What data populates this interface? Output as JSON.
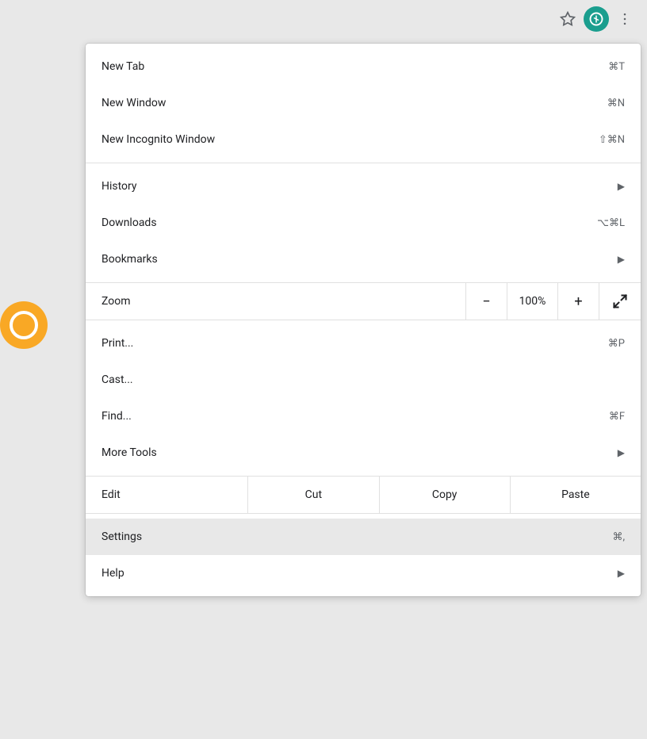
{
  "browser": {
    "icons": {
      "star": "☆",
      "dots": "⋮"
    }
  },
  "menu": {
    "sections": [
      {
        "id": "section-1",
        "items": [
          {
            "id": "new-tab",
            "label": "New Tab",
            "shortcut": "⌘T",
            "hasArrow": false
          },
          {
            "id": "new-window",
            "label": "New Window",
            "shortcut": "⌘N",
            "hasArrow": false
          },
          {
            "id": "new-incognito",
            "label": "New Incognito Window",
            "shortcut": "⇧⌘N",
            "hasArrow": false
          }
        ]
      },
      {
        "id": "section-2",
        "items": [
          {
            "id": "history",
            "label": "History",
            "shortcut": "",
            "hasArrow": true
          },
          {
            "id": "downloads",
            "label": "Downloads",
            "shortcut": "⌥⌘L",
            "hasArrow": false
          },
          {
            "id": "bookmarks",
            "label": "Bookmarks",
            "shortcut": "",
            "hasArrow": true
          }
        ]
      },
      {
        "id": "section-zoom",
        "type": "zoom",
        "label": "Zoom",
        "minus": "−",
        "value": "100%",
        "plus": "+",
        "fullscreen": "fullscreen"
      },
      {
        "id": "section-3",
        "items": [
          {
            "id": "print",
            "label": "Print...",
            "shortcut": "⌘P",
            "hasArrow": false
          },
          {
            "id": "cast",
            "label": "Cast...",
            "shortcut": "",
            "hasArrow": false
          },
          {
            "id": "find",
            "label": "Find...",
            "shortcut": "⌘F",
            "hasArrow": false
          },
          {
            "id": "more-tools",
            "label": "More Tools",
            "shortcut": "",
            "hasArrow": true
          }
        ]
      },
      {
        "id": "section-edit",
        "type": "edit",
        "label": "Edit",
        "actions": [
          "Cut",
          "Copy",
          "Paste"
        ]
      },
      {
        "id": "section-4",
        "items": [
          {
            "id": "settings",
            "label": "Settings",
            "shortcut": "⌘,",
            "hasArrow": false,
            "highlighted": true
          },
          {
            "id": "help",
            "label": "Help",
            "shortcut": "",
            "hasArrow": true
          }
        ]
      }
    ]
  }
}
